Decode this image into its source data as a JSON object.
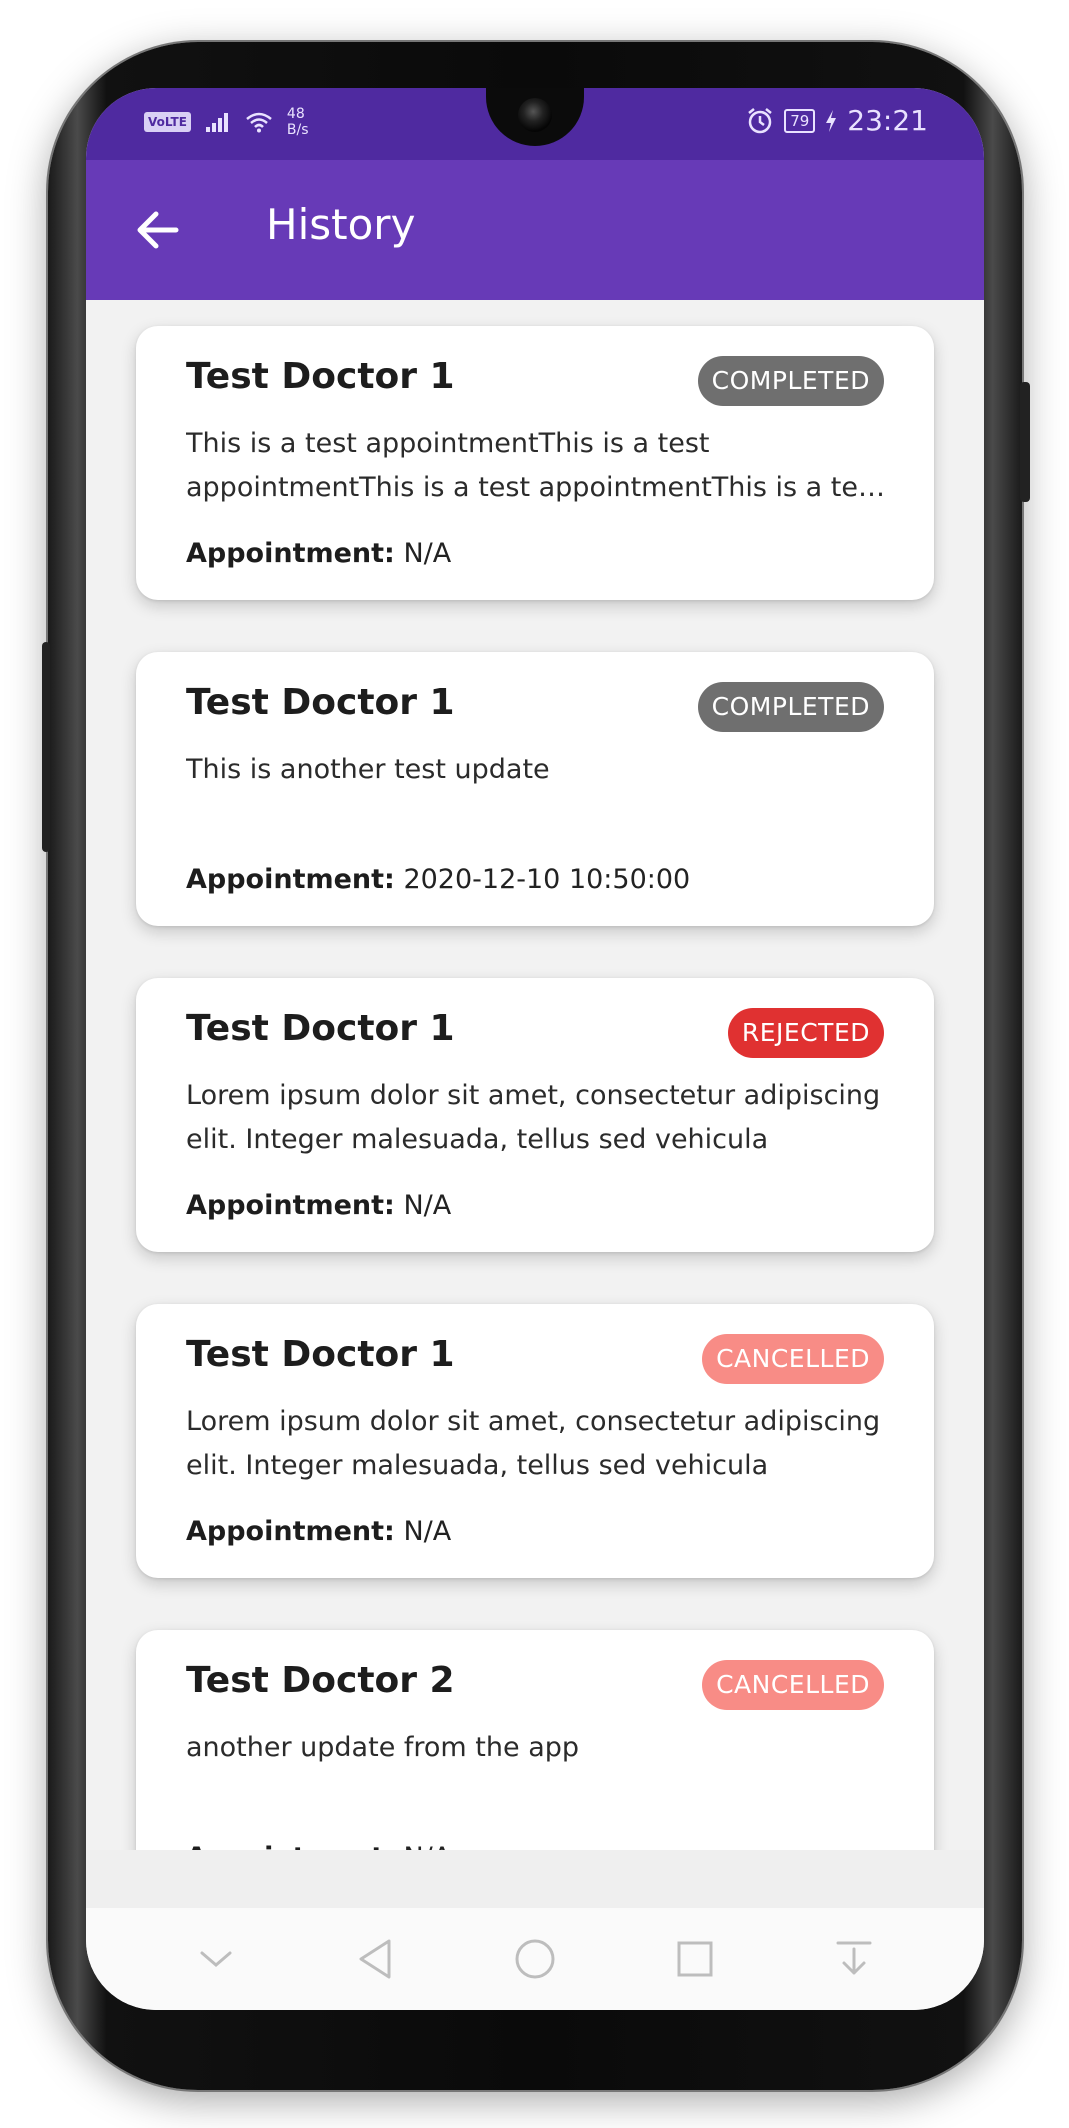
{
  "status_bar": {
    "volte": "VoLTE",
    "net_speed_value": "48",
    "net_speed_unit": "B/s",
    "battery": "79",
    "time": "23:21"
  },
  "app_bar": {
    "title": "History"
  },
  "labels": {
    "appointment": "Appointment:"
  },
  "cards": [
    {
      "doctor": "Test Doctor 1",
      "status": "COMPLETED",
      "status_color": "#6f6f6f",
      "description": "This is a test appointmentThis is a test appointmentThis is a test appointmentThis is a test appointment",
      "appointment": "N/A"
    },
    {
      "doctor": "Test Doctor 1",
      "status": "COMPLETED",
      "status_color": "#6f6f6f",
      "description": "This is another test update",
      "appointment": "2020-12-10  10:50:00"
    },
    {
      "doctor": "Test Doctor 1",
      "status": "REJECTED",
      "status_color": "#e03131",
      "description": "Lorem ipsum dolor sit amet, consectetur adipiscing elit. Integer malesuada, tellus sed vehicula",
      "appointment": "N/A"
    },
    {
      "doctor": "Test Doctor 1",
      "status": "CANCELLED",
      "status_color": "#f88c86",
      "description": "Lorem ipsum dolor sit amet, consectetur adipiscing elit. Integer malesuada, tellus sed vehicula",
      "appointment": "N/A"
    },
    {
      "doctor": "Test Doctor 2",
      "status": "CANCELLED",
      "status_color": "#f88c86",
      "description": "another update from the app",
      "appointment": "N/A"
    }
  ],
  "colors": {
    "primary": "#673ab7",
    "status_bar": "#4f2aa0"
  },
  "icons": {
    "back": "arrow-left-icon",
    "nav_hide": "chevron-down-icon",
    "nav_back": "triangle-back-icon",
    "nav_home": "circle-home-icon",
    "nav_recents": "square-recents-icon",
    "nav_notifications": "pull-down-icon"
  }
}
